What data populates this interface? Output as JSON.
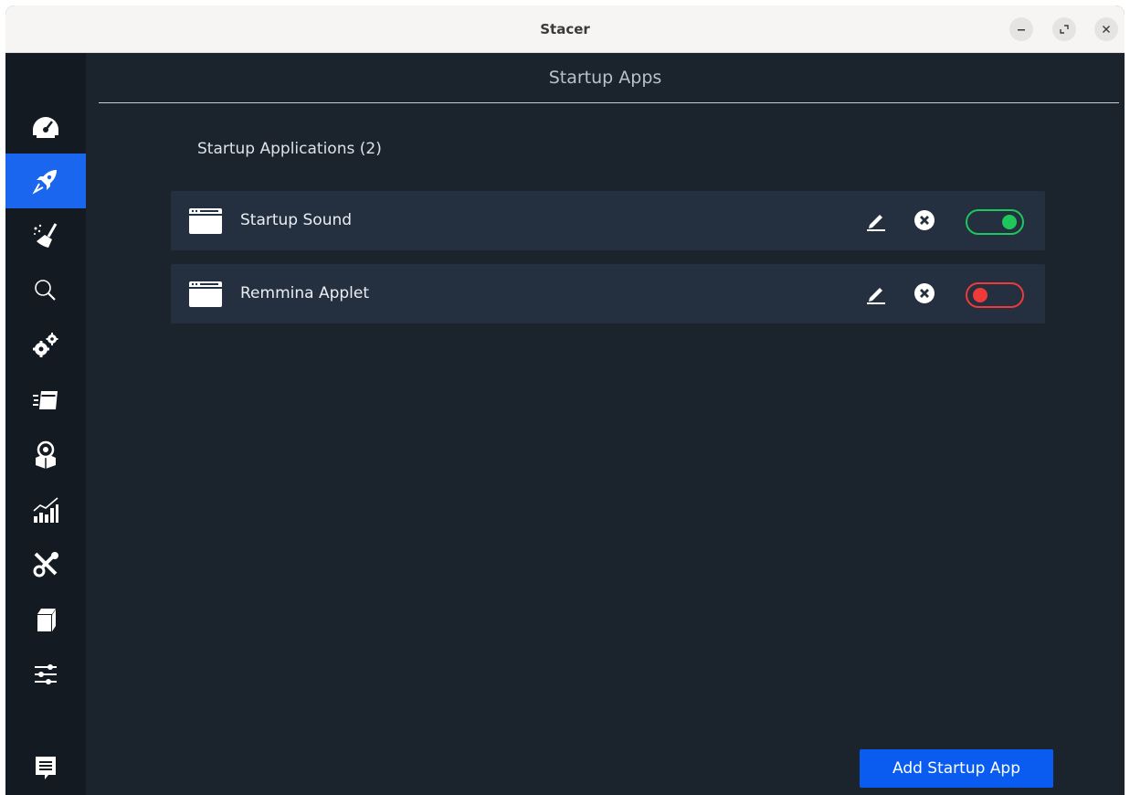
{
  "window": {
    "title": "Stacer"
  },
  "page": {
    "title": "Startup Apps",
    "section_label": "Startup Applications (2)"
  },
  "sidebar": {
    "items": [
      {
        "icon": "dashboard-gauge-icon",
        "active": false
      },
      {
        "icon": "rocket-icon",
        "active": true
      },
      {
        "icon": "broom-cleaner-icon",
        "active": false
      },
      {
        "icon": "search-icon",
        "active": false
      },
      {
        "icon": "gears-icon",
        "active": false
      },
      {
        "icon": "processes-icon",
        "active": false
      },
      {
        "icon": "uninstaller-package-icon",
        "active": false
      },
      {
        "icon": "resources-chart-icon",
        "active": false
      },
      {
        "icon": "tools-icon",
        "active": false
      },
      {
        "icon": "apt-repository-box-icon",
        "active": false
      },
      {
        "icon": "settings-sliders-icon",
        "active": false
      },
      {
        "icon": "feedback-icon",
        "active": false
      }
    ]
  },
  "startup_apps": [
    {
      "name": "Startup Sound",
      "enabled": true
    },
    {
      "name": "Remmina Applet",
      "enabled": false
    }
  ],
  "actions": {
    "add_label": "Add Startup App"
  },
  "colors": {
    "accent": "#1a66ee",
    "toggle_on": "#1ec75a",
    "toggle_off": "#f03a3a",
    "background": "#1b232d",
    "sidebar": "#131a22",
    "row": "#243040"
  }
}
